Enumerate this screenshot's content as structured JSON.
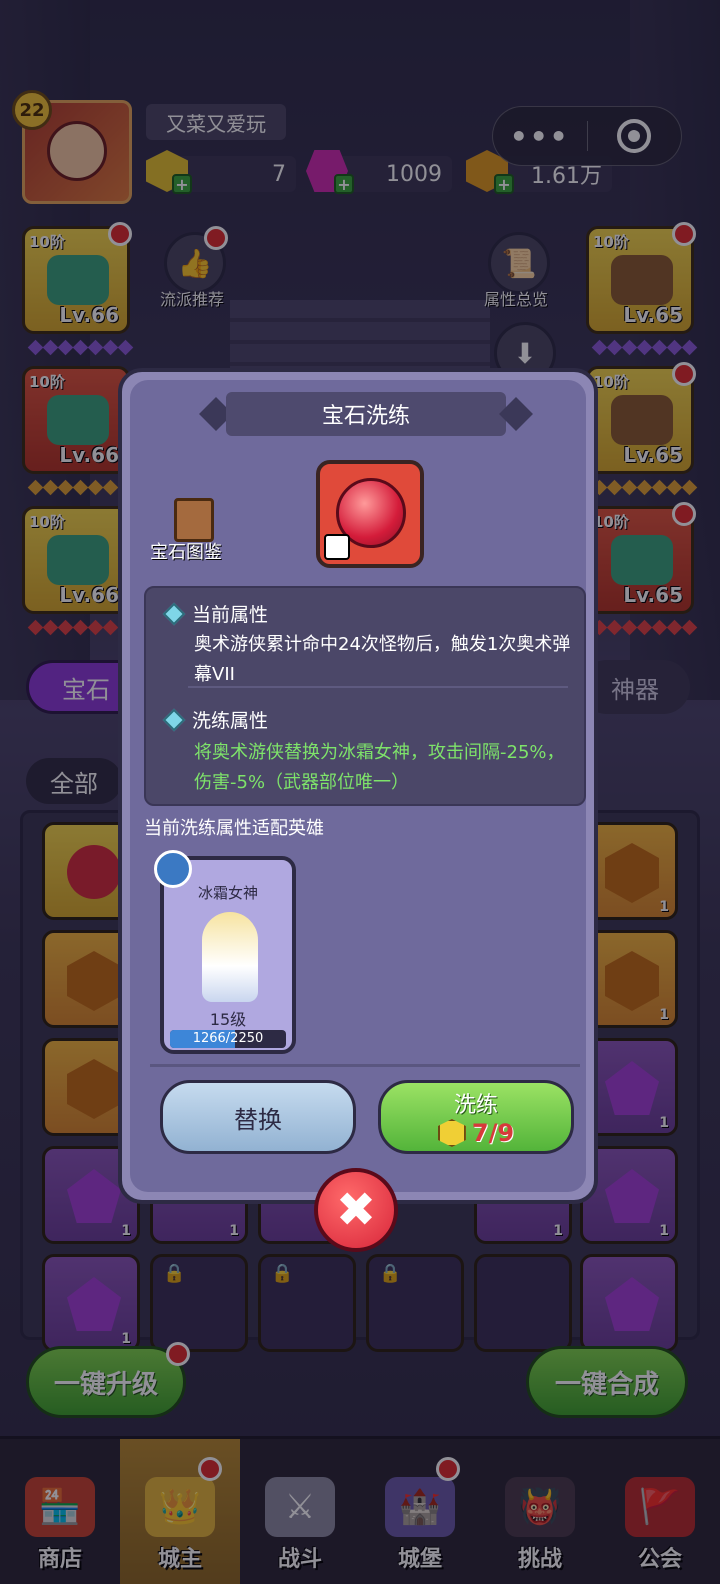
{
  "player": {
    "level": "22",
    "name": "又菜又爱玩"
  },
  "resources": {
    "gold": "7",
    "gems": "1009",
    "coins": "1.61万"
  },
  "capsule": {
    "more": "•••"
  },
  "actions": {
    "recommend": "流派推荐",
    "attributes": "属性总览"
  },
  "equipment": [
    {
      "tier": "10阶",
      "level": "Lv.66"
    },
    {
      "tier": "10阶",
      "level": "Lv.66"
    },
    {
      "tier": "10阶",
      "level": "Lv.66"
    },
    {
      "tier": "10阶",
      "level": "Lv.65"
    },
    {
      "tier": "10阶",
      "level": "Lv.65"
    },
    {
      "tier": "10阶",
      "level": "Lv.65"
    }
  ],
  "tabs": {
    "gem_partial": "宝石",
    "artifact_partial": "神器",
    "all": "全部"
  },
  "bag_counts": [
    "1",
    "1",
    "1",
    "1",
    "1",
    "1",
    "1",
    "1",
    "1"
  ],
  "bottom_buttons": {
    "upgrade_all": "一键升级",
    "merge_all": "一键合成"
  },
  "nav": [
    {
      "label": "商店",
      "icon": "shop-icon"
    },
    {
      "label": "城主",
      "icon": "crown-icon"
    },
    {
      "label": "战斗",
      "icon": "swords-icon"
    },
    {
      "label": "城堡",
      "icon": "castle-icon"
    },
    {
      "label": "挑战",
      "icon": "demon-icon"
    },
    {
      "label": "公会",
      "icon": "banner-icon"
    }
  ],
  "modal": {
    "title": "宝石洗练",
    "book_label": "宝石图鉴",
    "current_attr_title": "当前属性",
    "current_attr_text": "奥术游侠累计命中24次怪物后，触发1次奥术弹幕VII",
    "refine_attr_title": "洗练属性",
    "refine_attr_text": "将奥术游侠替换为冰霜女神，攻击间隔-25%，伤害-5%（武器部位唯一）",
    "hero_caption": "当前洗练属性适配英雄",
    "hero": {
      "name": "冰霜女神",
      "level": "15级",
      "exp": "1266/2250",
      "exp_fraction": 0.5627
    },
    "replace_label": "替换",
    "refine_label": "洗练",
    "refine_cost": "7/9",
    "close": "✖"
  },
  "colors": {
    "accent_green": "#53b43a",
    "modal_bg": "#6f6a9c",
    "refine_text": "#7ee36a"
  }
}
